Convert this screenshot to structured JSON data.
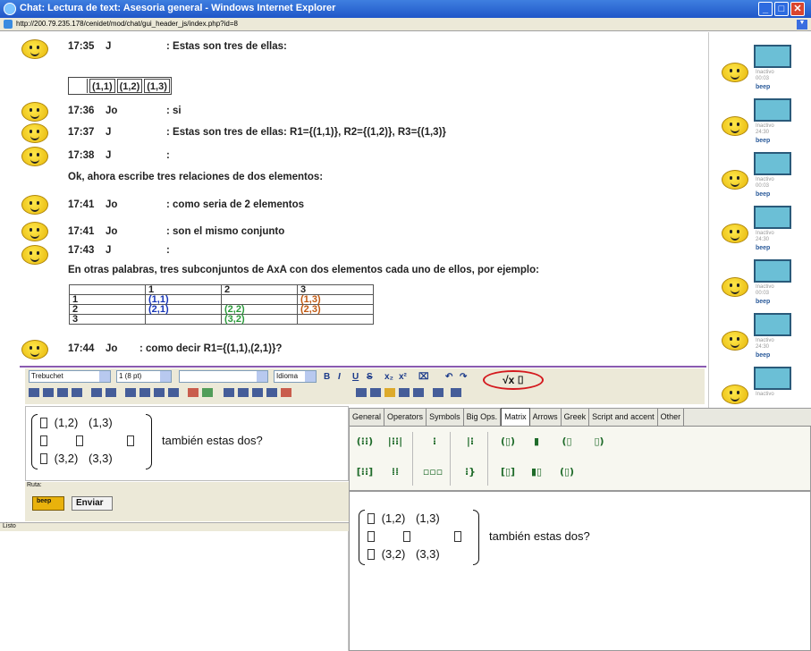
{
  "window": {
    "title": "Chat: Lectura de text: Asesoria general - Windows Internet Explorer",
    "url": "http://200.79.235.178/cenidet/mod/chat/gui_header_js/index.php?id=8"
  },
  "chat": {
    "messages": [
      {
        "time": "17:35",
        "user": "J",
        "text": ": Estas son tres de ellas:"
      },
      {
        "time": "17:36",
        "user": "Jo",
        "text": ": si"
      },
      {
        "time": "17:37",
        "user": "J",
        "text": ": Estas son tres de ellas: R1={(1,1)}, R2={(1,2)}, R3={(1,3)}"
      },
      {
        "time": "17:38",
        "user": "J",
        "text": ":"
      },
      {
        "time": "",
        "user": "",
        "text": "Ok, ahora escribe tres relaciones de dos elementos:"
      },
      {
        "time": "17:41",
        "user": "Jo",
        "text": ": como seria de 2 elementos"
      },
      {
        "time": "17:41",
        "user": "Jo",
        "text": ": son el mismo conjunto"
      },
      {
        "time": "17:43",
        "user": "J",
        "text": ":"
      },
      {
        "time": "",
        "user": "",
        "text": "En otras palabras, tres subconjuntos de AxA con dos elementos cada uno de ellos, por ejemplo:"
      },
      {
        "time": "17:44",
        "user": "Jo",
        "text": ": como decir R1={(1,1),(2,1)}?"
      }
    ],
    "mini_cells": [
      "(1,1)",
      "(1,2)",
      "(1,3)"
    ],
    "relation_table": {
      "headers": [
        "",
        "1",
        "2",
        "3"
      ],
      "rows": [
        [
          "1",
          "(1,1)",
          "",
          "(1,3)"
        ],
        [
          "2",
          "(2,1)",
          "(2,2)",
          "(2,3)"
        ],
        [
          "3",
          "",
          "(3,2)",
          ""
        ]
      ]
    }
  },
  "sidebar": {
    "users": [
      {
        "status": "Inactivo",
        "time": "00:03",
        "beep": "beep"
      },
      {
        "status": "Inactivo",
        "time": "24:30",
        "beep": "beep"
      },
      {
        "status": "Inactivo",
        "time": "00:03",
        "beep": "beep"
      },
      {
        "status": "Inactivo",
        "time": "24:30",
        "beep": "beep"
      },
      {
        "status": "Inactivo",
        "time": "00:03",
        "beep": "beep"
      },
      {
        "status": "Inactivo",
        "time": "24:30",
        "beep": "beep"
      },
      {
        "status": "Inactivo",
        "time": "",
        "beep": ""
      }
    ]
  },
  "toolbar": {
    "font": "Trebuchet",
    "size": "1 (8 pt)",
    "style": "",
    "language": "Idioma",
    "bold": "B",
    "italic": "I",
    "underline": "U",
    "strike": "S",
    "equation_button": "√x ⌷"
  },
  "editor": {
    "matrix_rows": [
      [
        "",
        "(1,2)",
        "(1,3)"
      ],
      [
        "",
        "",
        ""
      ],
      [
        "",
        "(3,2)",
        "(3,3)"
      ]
    ],
    "text": "también estas dos?"
  },
  "ruta_label": "Ruta:",
  "actions": {
    "beep": "beep",
    "send": "Enviar"
  },
  "status": "Listo",
  "palette": {
    "tabs": [
      "General",
      "Operators",
      "Symbols",
      "Big Ops.",
      "Matrix",
      "Arrows",
      "Greek",
      "Script and accent",
      "Other"
    ],
    "active_tab": "Matrix"
  }
}
